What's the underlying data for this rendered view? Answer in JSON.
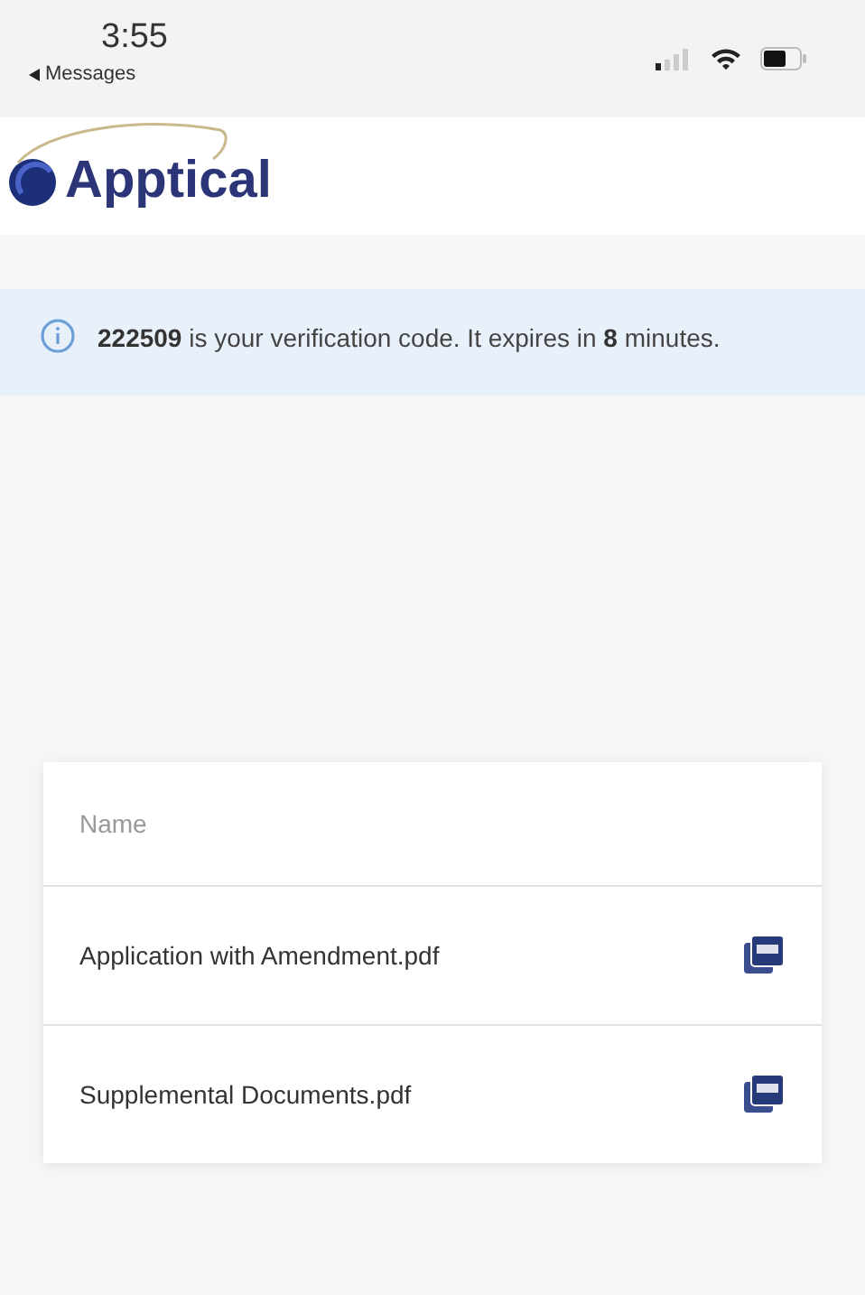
{
  "status_bar": {
    "time": "3:55",
    "back_label": "Messages"
  },
  "logo": {
    "text": "Apptical"
  },
  "notice": {
    "text": "**222509** is your verification code. It expires in **8** minutes."
  },
  "table": {
    "columns": [
      "Name"
    ],
    "rows": [
      {
        "name": "Application with Amendment.pdf"
      },
      {
        "name": "Supplemental Documents.pdf"
      }
    ]
  }
}
